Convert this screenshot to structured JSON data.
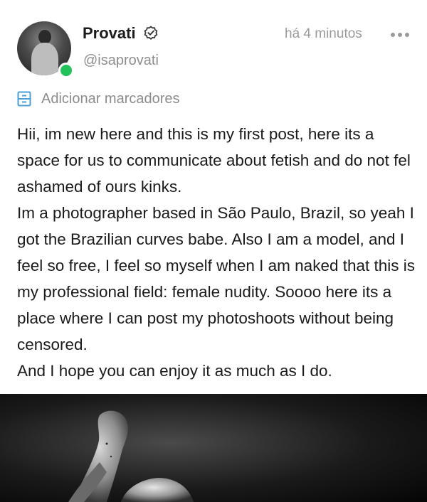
{
  "author": {
    "name": "Provati",
    "handle": "@isaprovati",
    "online": true,
    "verified_icon": "badge-check-icon"
  },
  "timestamp": "há 4 minutos",
  "menu_icon": "more-horizontal-icon",
  "bookmarks": {
    "icon": "bookmark-list-icon",
    "label": "Adicionar marcadores"
  },
  "colors": {
    "online": "#22c25a",
    "accent_icon": "#4a9fd8",
    "muted_text": "#8e8e8e"
  },
  "post": {
    "paragraphs": [
      "Hii, im new here and this is my first post, here its a space for us to communicate about fetish and do not fel ashamed of ours kinks.",
      "Im a photographer based in São Paulo, Brazil, so yeah I got the Brazilian curves babe. Also I am a model, and I feel so free, I feel so myself when I am naked that this is my professional field: female nudity. Soooo here its a place where I can post my photoshoots without being censored.",
      "And I hope you can enjoy it as much as I do."
    ]
  },
  "media": {
    "type": "photo",
    "description": "black-and-white photo"
  }
}
